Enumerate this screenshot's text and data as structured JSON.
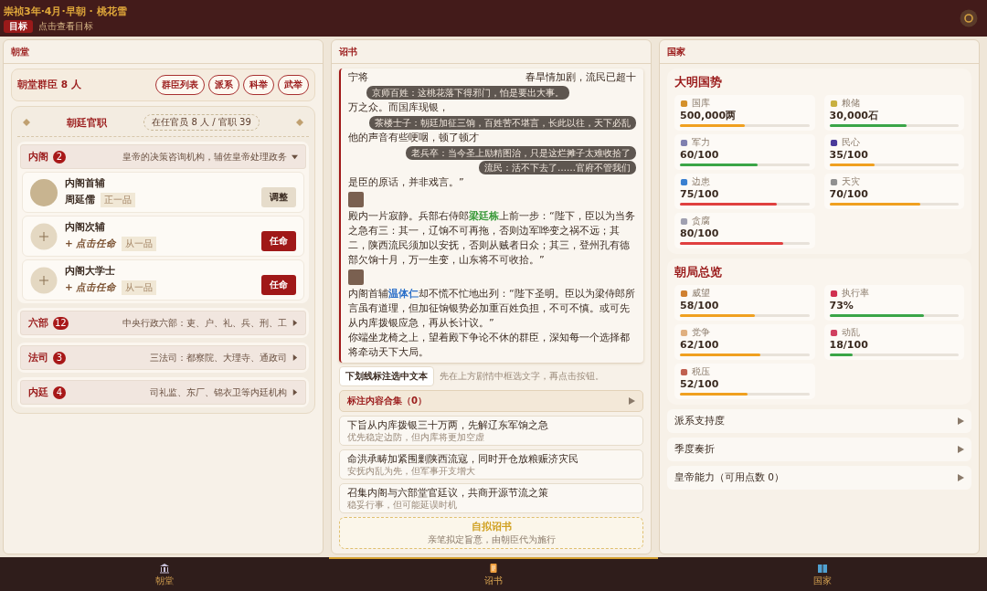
{
  "top_bar": {
    "title": "崇祯3年·4月·早朝 · 桃花雪",
    "goal_badge": "目标",
    "goal_hint": "点击查看目标"
  },
  "court": {
    "title": "朝堂",
    "summary": "朝堂群臣 8 人",
    "buttons": [
      "群臣列表",
      "派系",
      "科举",
      "武举"
    ],
    "offices_title": "朝廷官职",
    "offices_count": "在任官员 8 人 / 官职 39",
    "groups": [
      {
        "name": "内阁",
        "count": "2",
        "desc": "皇帝的决策咨询机构，辅佐皇帝处理政务",
        "expanded": true,
        "posts": [
          {
            "kind": "filled",
            "title": "内阁首辅",
            "holder": "周延儒",
            "rank": "正一品",
            "action": "调整"
          },
          {
            "kind": "vacant",
            "title": "内阁次辅",
            "holder": "+ 点击任命",
            "rank": "从一品",
            "action": "任命"
          },
          {
            "kind": "vacant",
            "title": "内阁大学士",
            "holder": "+ 点击任命",
            "rank": "从一品",
            "action": "任命"
          }
        ]
      },
      {
        "name": "六部",
        "count": "12",
        "desc": "中央行政六部：吏、户、礼、兵、刑、工",
        "expanded": false
      },
      {
        "name": "法司",
        "count": "3",
        "desc": "三法司：都察院、大理寺、通政司",
        "expanded": false
      },
      {
        "name": "内廷",
        "count": "4",
        "desc": "司礼监、东厂、锦衣卫等内廷机构",
        "expanded": false
      }
    ]
  },
  "edict": {
    "title": "诏书",
    "covered_lines": [
      [
        "宁将",
        "春旱情加剧，流民已超十"
      ],
      [
        "万之众。而国库现银，"
      ],
      [
        "他的声音有些哽咽，顿了顿才"
      ],
      [
        "是臣的原话，并非戏言。”"
      ]
    ],
    "bubbles": [
      "京师百姓：这桃花落下得邪门，怕是要出大事。",
      "茶楼士子：朝廷加征三饷，百姓苦不堪言，长此以往，天下必乱",
      "老兵卒：当今圣上励精图治，只是这烂摊子太难收拾了",
      "流民：活不下去了……官府不管我们"
    ],
    "paragraphs": [
      {
        "avatar": true,
        "parts": [
          {
            "text": "殿内一片寂静。兵部右侍郎"
          },
          {
            "text": "梁廷栋",
            "color": "#3a9a3a"
          },
          {
            "text": "上前一步：“陛下，臣以为当务之急有三：其一，辽饷不可再拖，否则边军哗变之祸不远；其二，陕西流民须加以安抚，否则从贼者日众；其三，登州孔有德部欠饷十月，万一生变，山东将不可收拾。”"
          }
        ]
      },
      {
        "avatar": true,
        "parts": [
          {
            "text": "内阁首辅"
          },
          {
            "text": "温体仁",
            "color": "#2a6fc9"
          },
          {
            "text": "却不慌不忙地出列：“陛下圣明。臣以为梁侍郎所言虽有道理，但加征饷银势必加重百姓负担，不可不慎。或可先从内库拨银应急，再从长计议。”"
          }
        ]
      },
      {
        "avatar": false,
        "parts": [
          {
            "text": "你端坐龙椅之上，望着殿下争论不休的群臣，深知每一个选择都将牵动天下大局。"
          }
        ]
      }
    ],
    "mark_button": "下划线标注选中文本",
    "mark_hint": "先在上方剧情中框选文字，再点击按钮。",
    "collection": {
      "label": "标注内容合集（0）",
      "expanded": false
    },
    "choices": [
      {
        "title": "下旨从内库拨银三十万两，先解辽东军饷之急",
        "note": "优先稳定边防，但内库将更加空虚"
      },
      {
        "title": "命洪承畴加紧围剿陕西流寇，同时开仓放粮赈济灾民",
        "note": "安抚内乱为先，但军事开支增大"
      },
      {
        "title": "召集内阁与六部堂官廷议，共商开源节流之策",
        "note": "稳妥行事，但可能延误时机"
      }
    ],
    "custom": {
      "title": "自拟诏书",
      "note": "亲笔拟定旨意，由朝臣代为施行"
    }
  },
  "nation": {
    "title": "国家",
    "cards": [
      {
        "title": "大明国势",
        "stats": [
          {
            "kind": "treasury",
            "label": "国库",
            "value": "500,000两",
            "level": 0.5,
            "color": "#f0a020"
          },
          {
            "kind": "grain",
            "label": "粮储",
            "value": "30,000石",
            "level": 0.6,
            "color": "#3aa548"
          },
          {
            "kind": "army",
            "label": "军力",
            "value": "60/100",
            "level": 0.6,
            "color": "#3aa548"
          },
          {
            "kind": "people",
            "label": "民心",
            "value": "35/100",
            "level": 0.35,
            "color": "#f0a020"
          },
          {
            "kind": "border",
            "label": "边患",
            "value": "75/100",
            "level": 0.75,
            "color": "#e04040"
          },
          {
            "kind": "disaster",
            "label": "天灾",
            "value": "70/100",
            "level": 0.7,
            "color": "#f0a020"
          },
          {
            "kind": "corruption",
            "label": "贪腐",
            "value": "80/100",
            "level": 0.8,
            "color": "#e04040"
          }
        ]
      },
      {
        "title": "朝局总览",
        "stats": [
          {
            "kind": "prestige",
            "label": "威望",
            "value": "58/100",
            "level": 0.58,
            "color": "#f0a020"
          },
          {
            "kind": "execution",
            "label": "执行率",
            "value": "73%",
            "level": 0.73,
            "color": "#3aa548"
          },
          {
            "kind": "faction",
            "label": "党争",
            "value": "62/100",
            "level": 0.62,
            "color": "#f0a020"
          },
          {
            "kind": "unrest",
            "label": "动乱",
            "value": "18/100",
            "level": 0.18,
            "color": "#3aa548"
          },
          {
            "kind": "tax",
            "label": "税压",
            "value": "52/100",
            "level": 0.52,
            "color": "#f0a020"
          }
        ]
      }
    ],
    "sections": [
      {
        "label": "派系支持度",
        "expanded": false
      },
      {
        "label": "季度奏折",
        "expanded": false
      },
      {
        "label": "皇帝能力（可用点数 0）",
        "expanded": false
      }
    ]
  },
  "nav": [
    {
      "label": "朝堂",
      "selected": false
    },
    {
      "label": "诏书",
      "selected": true
    },
    {
      "label": "国家",
      "selected": false
    }
  ]
}
